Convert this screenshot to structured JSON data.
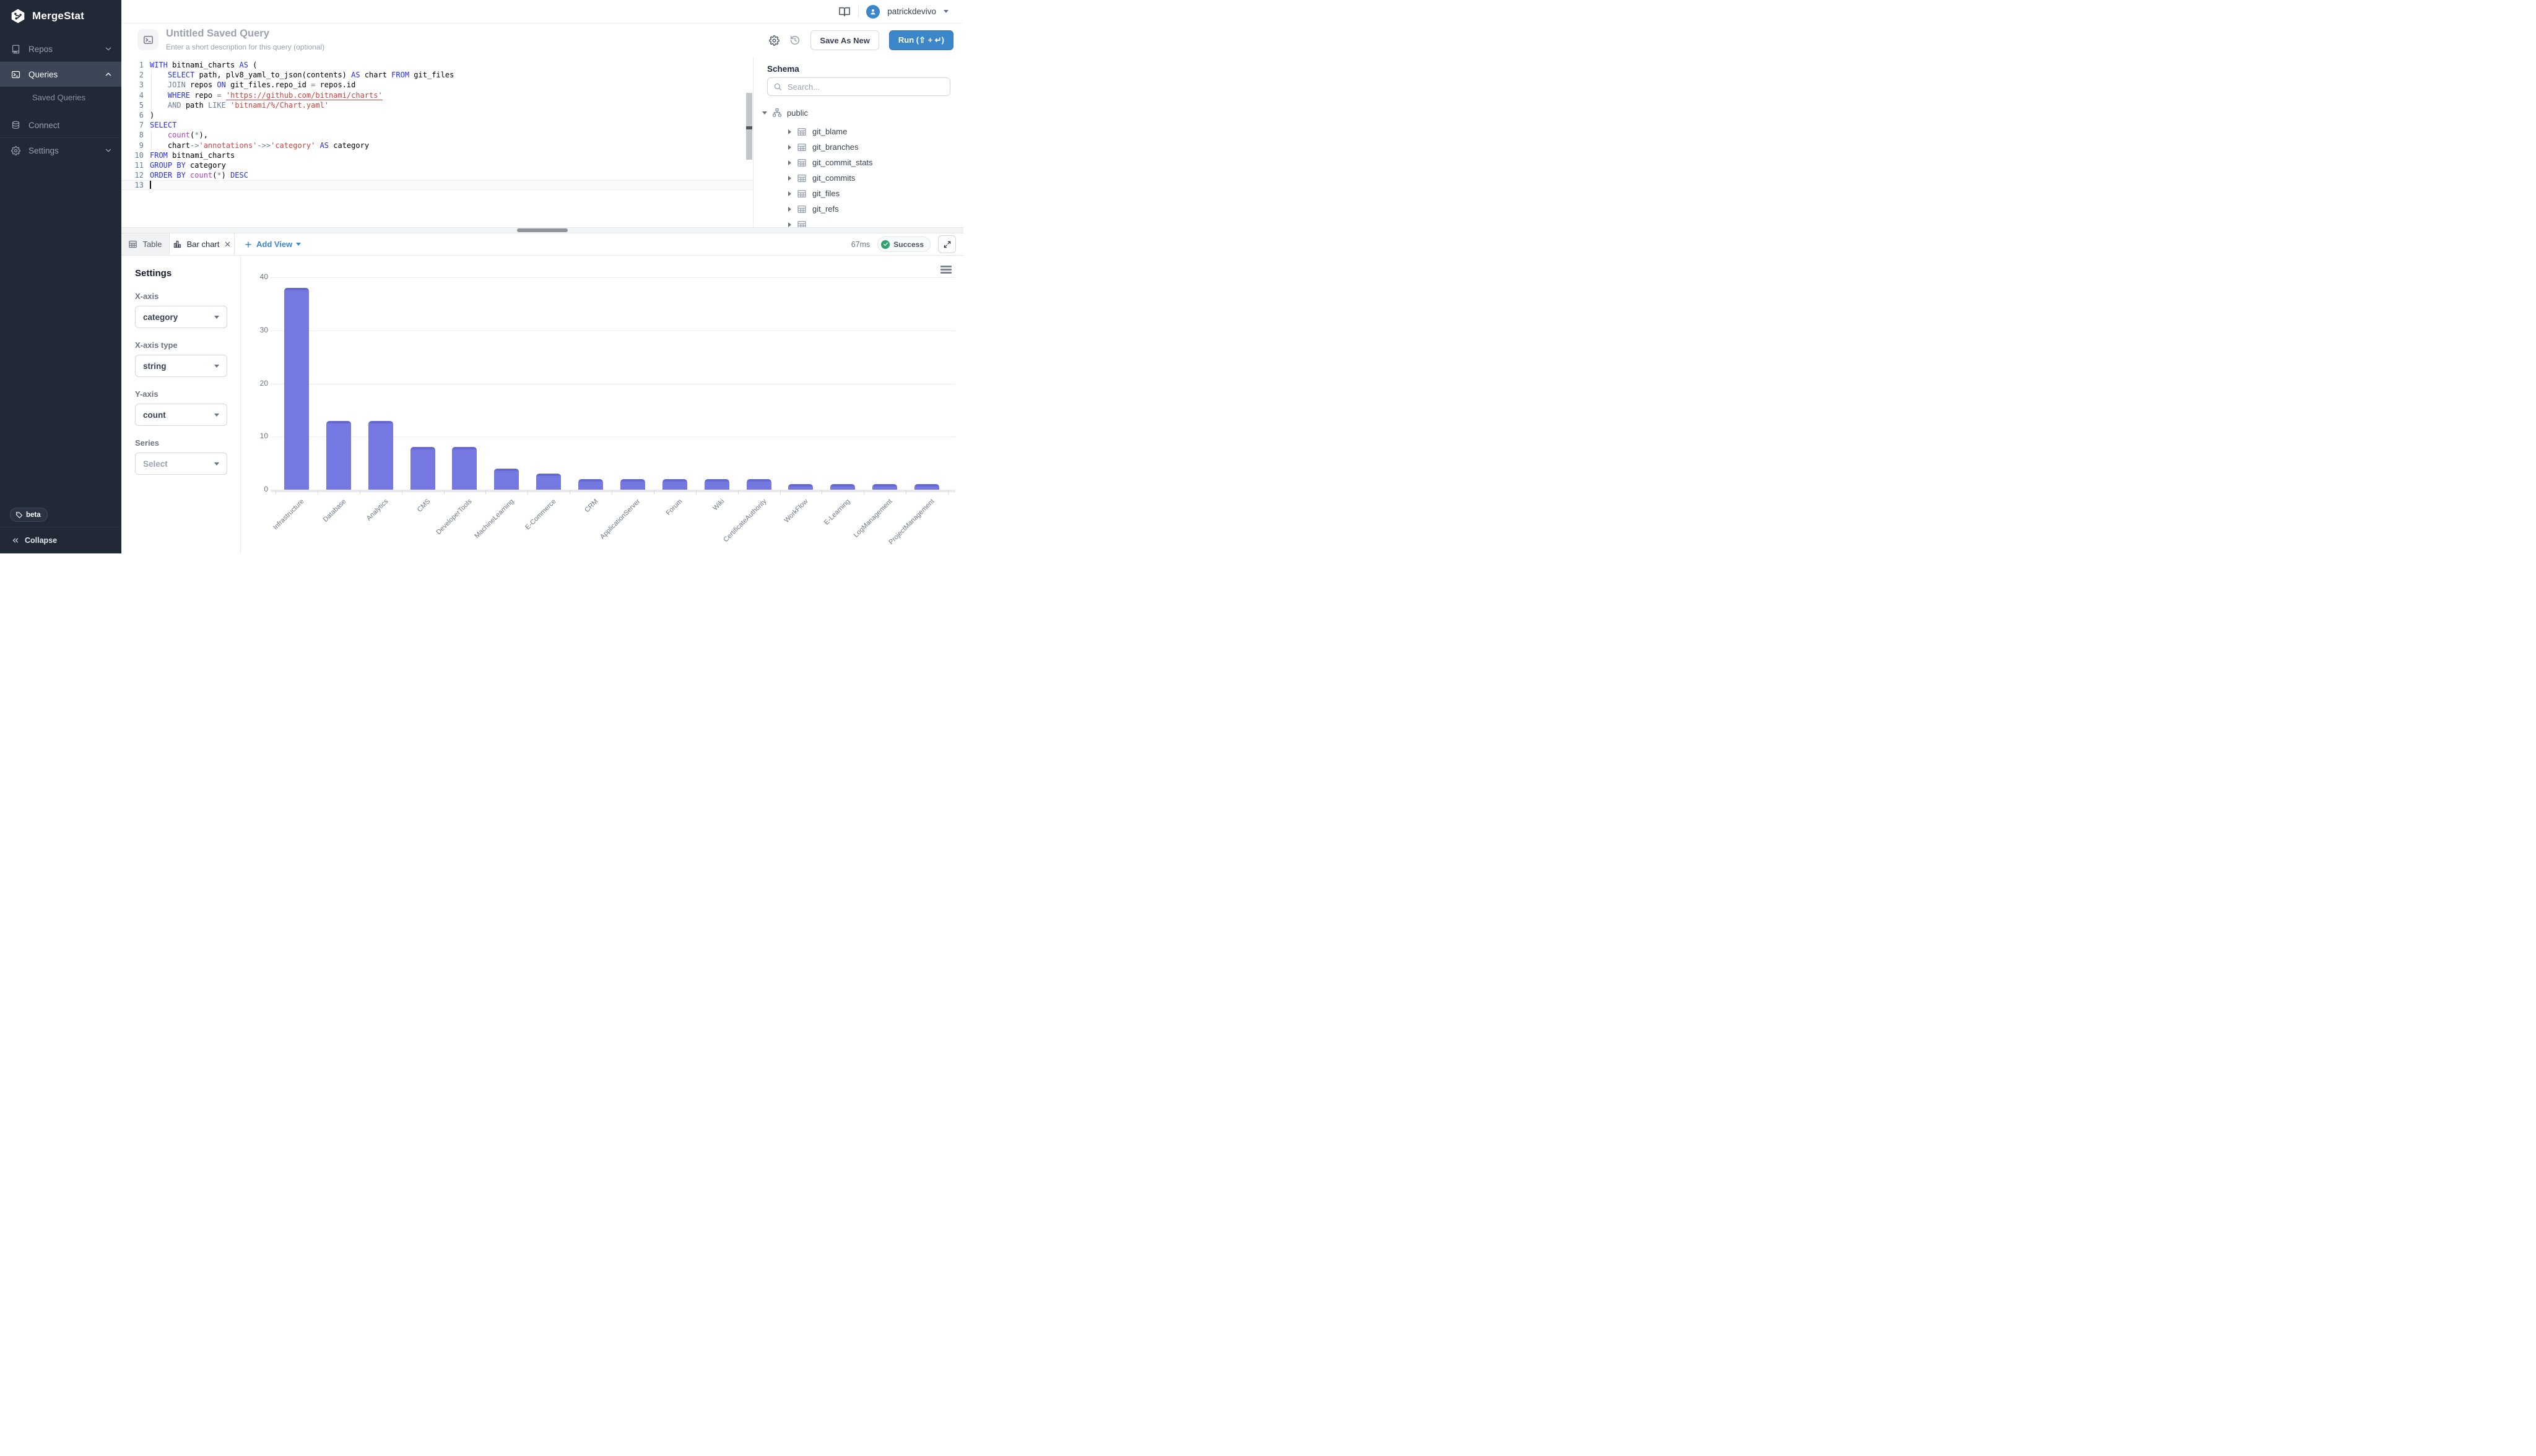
{
  "app": {
    "name": "MergeStat"
  },
  "sidebar": {
    "items": [
      {
        "label": "Repos"
      },
      {
        "label": "Queries"
      },
      {
        "label": "Connect"
      },
      {
        "label": "Settings"
      }
    ],
    "saved_queries_label": "Saved Queries",
    "beta_label": "beta",
    "collapse_label": "Collapse"
  },
  "topbar": {
    "username": "patrickdevivo"
  },
  "query_header": {
    "title": "Untitled Saved Query",
    "description_placeholder": "Enter a short description for this query (optional)",
    "save_as_new_label": "Save As New",
    "run_label": "Run (⇧ + ↵)"
  },
  "editor": {
    "lines": [
      {
        "tokens": [
          {
            "c": "k",
            "v": "WITH"
          },
          {
            "c": "p",
            "v": " bitnami_charts "
          },
          {
            "c": "k",
            "v": "AS"
          },
          {
            "c": "p",
            "v": " ("
          }
        ]
      },
      {
        "tokens": [
          {
            "c": "p",
            "v": "    "
          },
          {
            "c": "k",
            "v": "SELECT"
          },
          {
            "c": "p",
            "v": " path, plv8_yaml_to_json(contents) "
          },
          {
            "c": "k",
            "v": "AS"
          },
          {
            "c": "p",
            "v": " chart "
          },
          {
            "c": "k",
            "v": "FROM"
          },
          {
            "c": "p",
            "v": " git_files"
          }
        ]
      },
      {
        "tokens": [
          {
            "c": "p",
            "v": "    "
          },
          {
            "c": "g",
            "v": "JOIN"
          },
          {
            "c": "p",
            "v": " repos "
          },
          {
            "c": "k",
            "v": "ON"
          },
          {
            "c": "p",
            "v": " git_files.repo_id "
          },
          {
            "c": "g",
            "v": "="
          },
          {
            "c": "p",
            "v": " repos.id"
          }
        ]
      },
      {
        "tokens": [
          {
            "c": "p",
            "v": "    "
          },
          {
            "c": "k",
            "v": "WHERE"
          },
          {
            "c": "p",
            "v": " repo "
          },
          {
            "c": "g",
            "v": "="
          },
          {
            "c": "p",
            "v": " "
          },
          {
            "c": "u",
            "v": "'https://github.com/bitnami/charts'"
          }
        ]
      },
      {
        "tokens": [
          {
            "c": "p",
            "v": "    "
          },
          {
            "c": "g",
            "v": "AND"
          },
          {
            "c": "p",
            "v": " path "
          },
          {
            "c": "g",
            "v": "LIKE"
          },
          {
            "c": "p",
            "v": " "
          },
          {
            "c": "s",
            "v": "'bitnami/%/Chart.yaml'"
          }
        ]
      },
      {
        "tokens": [
          {
            "c": "p",
            "v": ")"
          }
        ]
      },
      {
        "tokens": [
          {
            "c": "k",
            "v": "SELECT"
          }
        ]
      },
      {
        "tokens": [
          {
            "c": "p",
            "v": "    "
          },
          {
            "c": "f",
            "v": "count"
          },
          {
            "c": "p",
            "v": "("
          },
          {
            "c": "g",
            "v": "*"
          },
          {
            "c": "p",
            "v": "),"
          }
        ]
      },
      {
        "tokens": [
          {
            "c": "p",
            "v": "    chart"
          },
          {
            "c": "g",
            "v": "->"
          },
          {
            "c": "s",
            "v": "'annotations'"
          },
          {
            "c": "g",
            "v": "->>"
          },
          {
            "c": "s",
            "v": "'category'"
          },
          {
            "c": "p",
            "v": " "
          },
          {
            "c": "k",
            "v": "AS"
          },
          {
            "c": "p",
            "v": " category"
          }
        ]
      },
      {
        "tokens": [
          {
            "c": "k",
            "v": "FROM"
          },
          {
            "c": "p",
            "v": " bitnami_charts"
          }
        ]
      },
      {
        "tokens": [
          {
            "c": "k",
            "v": "GROUP BY"
          },
          {
            "c": "p",
            "v": " category"
          }
        ]
      },
      {
        "tokens": [
          {
            "c": "k",
            "v": "ORDER BY"
          },
          {
            "c": "p",
            "v": " "
          },
          {
            "c": "f",
            "v": "count"
          },
          {
            "c": "p",
            "v": "("
          },
          {
            "c": "g",
            "v": "*"
          },
          {
            "c": "p",
            "v": ") "
          },
          {
            "c": "k",
            "v": "DESC"
          }
        ]
      },
      {
        "tokens": [],
        "cursor": true,
        "active": true
      }
    ]
  },
  "schema": {
    "title": "Schema",
    "search_placeholder": "Search...",
    "root_label": "public",
    "tables": [
      "git_blame",
      "git_branches",
      "git_commit_stats",
      "git_commits",
      "git_files",
      "git_refs"
    ]
  },
  "results_bar": {
    "tabs": [
      {
        "label": "Table"
      },
      {
        "label": "Bar chart"
      }
    ],
    "add_view_label": "Add View",
    "duration": "67ms",
    "status": "Success"
  },
  "settings_panel": {
    "title": "Settings",
    "fields": [
      {
        "label": "X-axis",
        "value": "category",
        "placeholder": false
      },
      {
        "label": "X-axis type",
        "value": "string",
        "placeholder": false
      },
      {
        "label": "Y-axis",
        "value": "count",
        "placeholder": false
      },
      {
        "label": "Series",
        "value": "Select",
        "placeholder": true
      }
    ]
  },
  "chart_data": {
    "type": "bar",
    "title": "",
    "xlabel": "",
    "ylabel": "",
    "categories": [
      "Infrastructure",
      "Database",
      "Analytics",
      "CMS",
      "DeveloperTools",
      "MachineLearning",
      "E-Commerce",
      "CRM",
      "ApplicationServer",
      "Forum",
      "Wiki",
      "CertificateAuthority",
      "WorkFlow",
      "E-Learning",
      "LogManagement",
      "ProjectManagement"
    ],
    "values": [
      38,
      13,
      13,
      8,
      8,
      4,
      3,
      2,
      2,
      2,
      2,
      2,
      1,
      1,
      1,
      1
    ],
    "ylim": [
      0,
      40
    ],
    "yticks": [
      0,
      10,
      20,
      30,
      40
    ],
    "grid": true,
    "legend": false,
    "bar_color": "#7578e0"
  },
  "icons": {
    "logo": "hexagon-nodes",
    "repos": "book",
    "queries": "terminal",
    "connect": "database",
    "settings": "gear",
    "docs": "open-book",
    "user": "person",
    "history": "history-clock",
    "search": "magnifier",
    "public": "sitemap",
    "table": "table-grid",
    "bar_chart": "bar-chart",
    "expand": "diagonal-arrows",
    "menu": "hamburger",
    "beta": "tag",
    "collapse": "double-chevron-left"
  },
  "colors": {
    "sidebar_bg": "#212936",
    "accent_blue": "#3c87c9",
    "success_green": "#2ea36c",
    "bar_purple": "#7578e0",
    "keyword_blue": "#2731e8",
    "string_red": "#cf423f",
    "function_magenta": "#b23fc6"
  }
}
